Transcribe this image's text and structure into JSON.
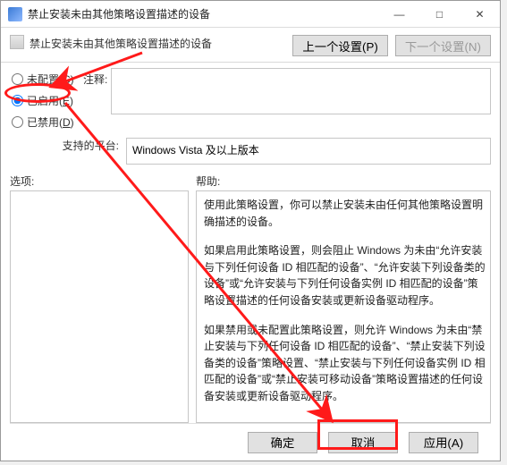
{
  "titlebar": {
    "title": "禁止安装未由其他策略设置描述的设备"
  },
  "subheader": {
    "subtitle": "禁止安装未由其他策略设置描述的设备",
    "prev_setting": "上一个设置(P)",
    "next_setting": "下一个设置(N)"
  },
  "radios": {
    "not_configured": "未配置(C)",
    "enabled": "已启用(E)",
    "disabled": "已禁用(D)"
  },
  "labels": {
    "comment": "注释:",
    "supported_platform": "支持的平台:",
    "options": "选项:",
    "help": "帮助:"
  },
  "platform_text": "Windows Vista 及以上版本",
  "help_paragraphs": [
    "使用此策略设置，你可以禁止安装未由任何其他策略设置明确描述的设备。",
    "如果启用此策略设置，则会阻止 Windows 为未由“允许安装与下列任何设备 ID 相匹配的设备”、“允许安装下列设备类的设备”或“允许安装与下列任何设备实例 ID 相匹配的设备”策略设置描述的任何设备安装或更新设备驱动程序。",
    "如果禁用或未配置此策略设置，则允许 Windows 为未由“禁止安装与下列任何设备 ID 相匹配的设备”、“禁止安装下列设备类的设备”策略设置、“禁止安装与下列任何设备实例 ID 相匹配的设备”或“禁止安装可移动设备”策略设置描述的任何设备安装或更新设备驱动程序。"
  ],
  "footer": {
    "ok": "确定",
    "cancel": "取消",
    "apply": "应用(A)"
  }
}
